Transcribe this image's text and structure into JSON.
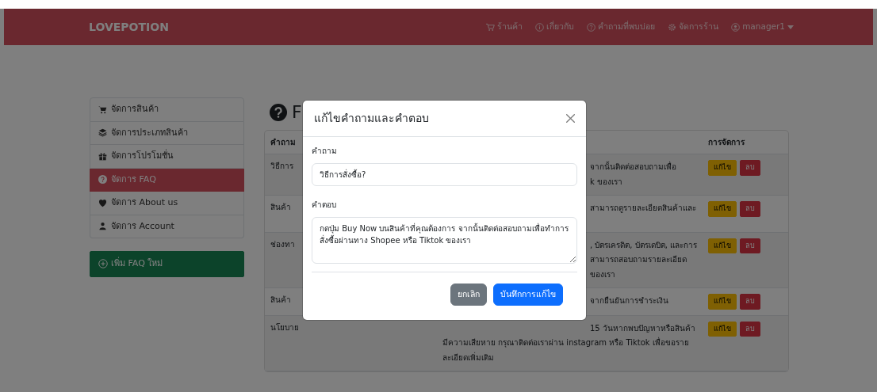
{
  "navbar": {
    "brand": "LOVEPOTION",
    "links": [
      {
        "label": "ร้านค้า"
      },
      {
        "label": "เกี่ยวกับ"
      },
      {
        "label": "คำถามที่พบบ่อย"
      },
      {
        "label": "จัดการร้าน"
      }
    ],
    "user": "manager1"
  },
  "sidebar": {
    "items": [
      {
        "label": "จัดการสินค้า",
        "selected": false
      },
      {
        "label": "จัดการประเภทสินค้า",
        "selected": false
      },
      {
        "label": "จัดการโปรโมชั่น",
        "selected": false
      },
      {
        "label": "จัดการ FAQ",
        "selected": true
      },
      {
        "label": "จัดการ About us",
        "selected": false
      },
      {
        "label": "จัดการ Account",
        "selected": false
      }
    ],
    "add_button": "เพิ่ม FAQ ใหม่"
  },
  "page_title": "F",
  "table": {
    "question_header": "คำถาม",
    "actions_header": "การจัดการ",
    "rows": [
      {
        "question": "วิธีการ",
        "answer_lines": [
          "จากนั้นติดต่อสอบถามเพื่อ",
          "k ของเรา"
        ],
        "edit": "แก้ไข",
        "delete": "ลบ"
      },
      {
        "question": "สินค้า",
        "answer_lines": [
          "สามารถดูรายละเอียดสินค้าและ"
        ],
        "edit": "แก้ไข",
        "delete": "ลบ"
      },
      {
        "question": "ช่องทา",
        "answer_lines": [
          ", บัตรเครดิต, บัตรเดบิต, และการ",
          "สามารถสอบถามรายละเอียด",
          "ของเรา"
        ],
        "edit": "แก้ไข",
        "delete": "ลบ"
      },
      {
        "question": "สินค้า",
        "answer_lines": [
          "จากยืนยันการชำระเงิน"
        ],
        "edit": "แก้ไข",
        "delete": "ลบ"
      },
      {
        "question": "นโยบาย",
        "answer_lines": [
          "15 วันหากพบปัญหาหรือสินค้า",
          "มีความเสียหาย กรุณาติดต่อเราผ่าน instagram หรือ Tiktok เพื่อขอราย",
          "ละเอียดเพิ่มเติม"
        ],
        "edit": "แก้ไข",
        "delete": "ลบ"
      }
    ]
  },
  "modal": {
    "title": "แก้ไขคำถามและคำตอบ",
    "question_label": "คำถาม",
    "question_value": "วิธีการสั่งซื้อ?",
    "answer_label": "คำตอบ",
    "answer_value": "กดปุ่ม Buy Now บนสินค้าที่คุณต้องการ จากนั้นติดต่อสอบถามเพื่อทำการสั่งซื้อผ่านทาง Shopee หรือ Tiktok ของเรา",
    "cancel": "ยกเลิก",
    "save": "บันทึกการแก้ไข"
  }
}
